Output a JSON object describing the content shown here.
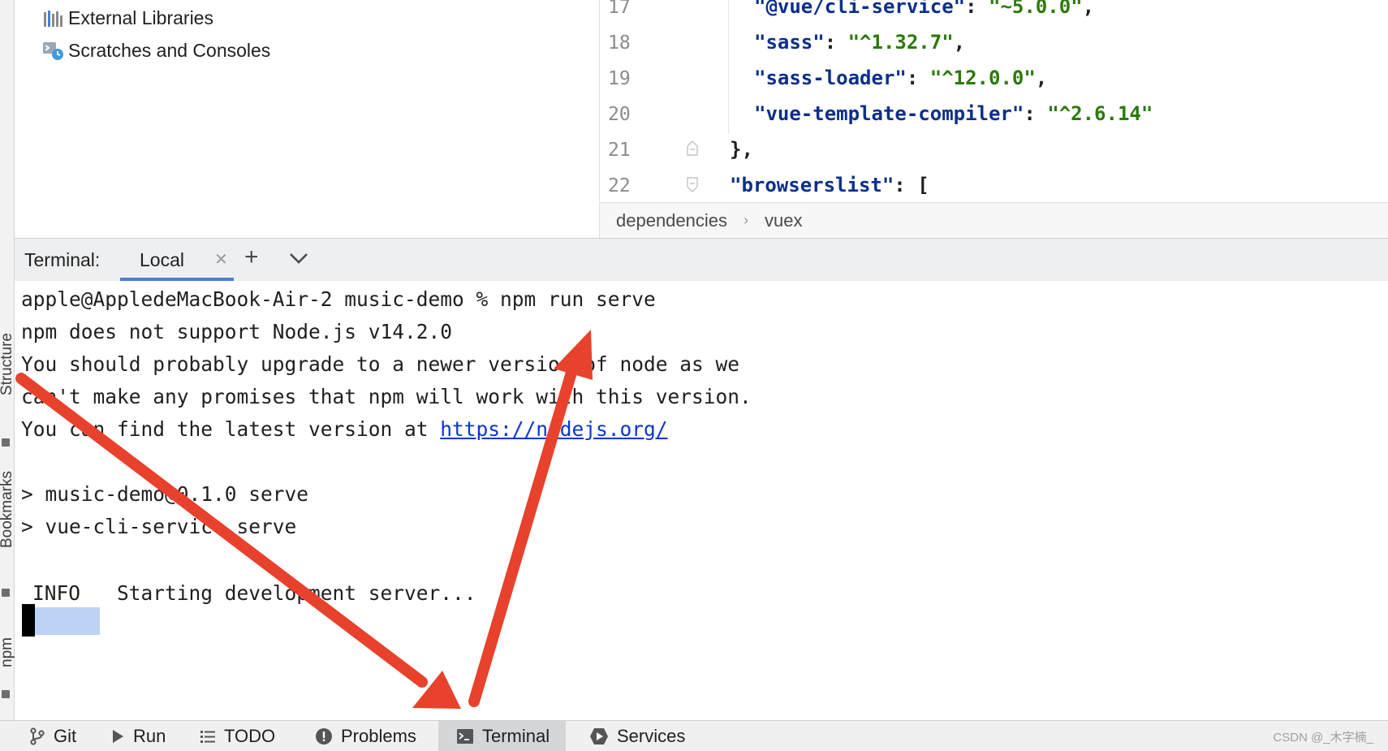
{
  "left_strip": {
    "labels": [
      "Structure",
      "Bookmarks",
      "npm"
    ]
  },
  "project_tree": {
    "items": [
      {
        "label": "External Libraries",
        "icon": "library-icon"
      },
      {
        "label": "Scratches and Consoles",
        "icon": "scratches-icon"
      }
    ]
  },
  "editor": {
    "lines": [
      {
        "num": "17",
        "key": "\"@vue/cli-service\"",
        "sep": ": ",
        "val": "\"~5.0.0\"",
        "tail": ","
      },
      {
        "num": "18",
        "key": "\"sass\"",
        "sep": ": ",
        "val": "\"^1.32.7\"",
        "tail": ","
      },
      {
        "num": "19",
        "key": "\"sass-loader\"",
        "sep": ": ",
        "val": "\"^12.0.0\"",
        "tail": ","
      },
      {
        "num": "20",
        "key": "\"vue-template-compiler\"",
        "sep": ": ",
        "val": "\"^2.6.14\"",
        "tail": ""
      },
      {
        "num": "21",
        "text": "},"
      },
      {
        "num": "22",
        "key": "\"browserslist\"",
        "sep": ": ",
        "tail": "["
      }
    ]
  },
  "breadcrumb": {
    "items": [
      "dependencies",
      "vuex"
    ]
  },
  "terminal": {
    "title": "Terminal:",
    "tab_label": "Local",
    "add_label": "+",
    "lines": [
      "apple@AppledeMacBook-Air-2 music-demo % npm run serve",
      "npm does not support Node.js v14.2.0",
      "You should probably upgrade to a newer version of node as we",
      "can't make any promises that npm will work with this version.",
      "You can find the latest version at ",
      "> music-demo@0.1.0 serve",
      "> vue-cli-service serve"
    ],
    "link": "https://nodejs.org/",
    "info_badge": "INFO",
    "info_text": "Starting development server..."
  },
  "status_bar": {
    "items": [
      {
        "label": "Git",
        "icon": "git-branch-icon"
      },
      {
        "label": "Run",
        "icon": "run-icon"
      },
      {
        "label": "TODO",
        "icon": "todo-list-icon"
      },
      {
        "label": "Problems",
        "icon": "problems-icon"
      },
      {
        "label": "Terminal",
        "icon": "terminal-icon"
      },
      {
        "label": "Services",
        "icon": "services-icon"
      }
    ],
    "watermark": "CSDN @_木字楠_"
  },
  "colors": {
    "accent": "#4a7fd0",
    "annotation_arrow": "#e8412c",
    "json_key": "#0b2f8a",
    "json_string": "#2b7a0b"
  }
}
